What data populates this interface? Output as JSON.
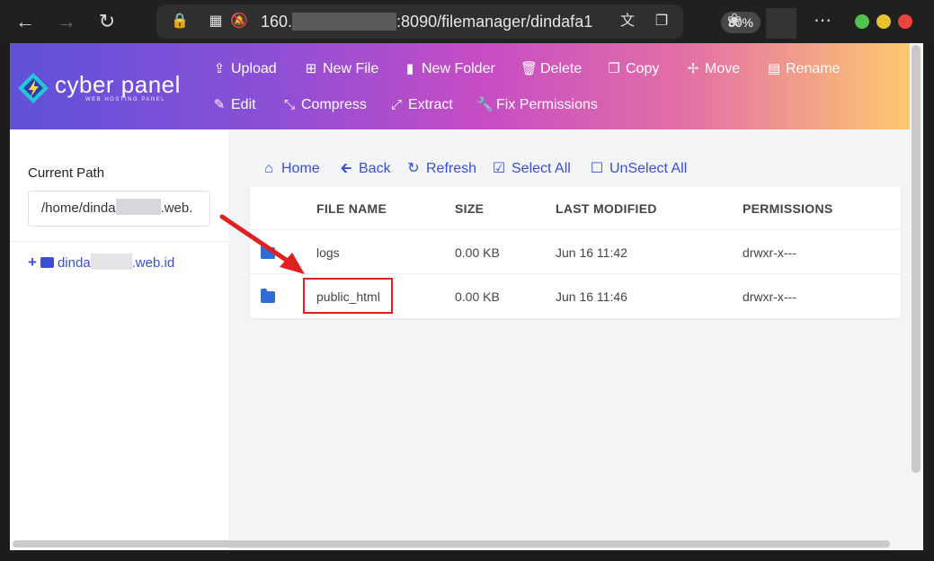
{
  "browser": {
    "url_prefix": "160.",
    "url_suffix": ":8090/filemanager/dindafa1",
    "zoom": "80%"
  },
  "logo": {
    "text": "cyber panel",
    "subtitle": "WEB HOSTING PANEL"
  },
  "toolbar": {
    "upload": "Upload",
    "new_file": "New File",
    "new_folder": "New Folder",
    "delete": "Delete",
    "copy": "Copy",
    "move": "Move",
    "rename": "Rename",
    "edit": "Edit",
    "compress": "Compress",
    "extract": "Extract",
    "fix_permissions": "Fix Permissions"
  },
  "sidebar": {
    "current_path_label": "Current Path",
    "path_prefix": "/home/dinda",
    "path_suffix": ".web.",
    "tree_prefix": "dinda",
    "tree_suffix": ".web.id"
  },
  "actions": {
    "home": "Home",
    "back": "Back",
    "refresh": "Refresh",
    "select_all": "Select All",
    "unselect_all": "UnSelect All"
  },
  "table": {
    "headers": [
      "FILE NAME",
      "SIZE",
      "LAST MODIFIED",
      "PERMISSIONS"
    ],
    "rows": [
      {
        "name": "logs",
        "size": "0.00 KB",
        "modified": "Jun 16 11:42",
        "permissions": "drwxr-x---"
      },
      {
        "name": "public_html",
        "size": "0.00 KB",
        "modified": "Jun 16 11:46",
        "permissions": "drwxr-x---"
      }
    ]
  },
  "colors": {
    "accent": "#3b4fd2",
    "folder": "#2f6cd3",
    "annotation": "#e02020"
  }
}
